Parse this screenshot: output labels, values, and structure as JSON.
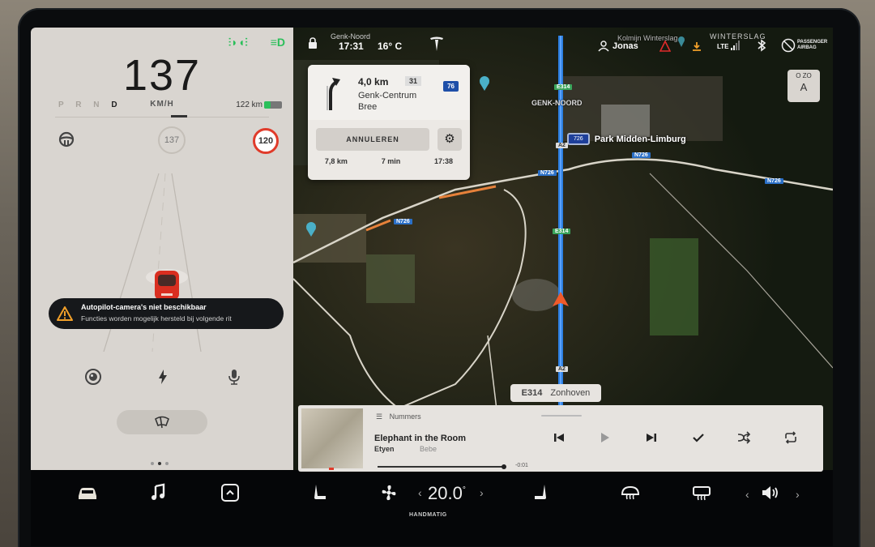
{
  "left_panel": {
    "speed": "137",
    "gears": [
      "P",
      "R",
      "N",
      "D"
    ],
    "active_gear": "D",
    "speed_unit": "KM/H",
    "range": "122 km",
    "battery_level": 0.35,
    "set_speed": "137",
    "speed_limit": "120",
    "alert": {
      "title": "Autopilot-camera's niet beschikbaar",
      "subtitle": "Functies worden mogelijk hersteld bij volgende rit"
    },
    "page_count": 3,
    "active_page": 2
  },
  "status_bar": {
    "location": "Genk-Noord",
    "time": "17:31",
    "temperature": "16° C",
    "user": "Jonas",
    "network": "LTE",
    "airbag_label": "PASSENGER AIRBAG"
  },
  "navigation": {
    "distance": "4,0 km",
    "exit_number": "31",
    "route_badge": "76",
    "destination_line1": "Genk-Centrum",
    "destination_line2": "Bree",
    "cancel_label": "ANNULEREN",
    "trip_distance": "7,8 km",
    "trip_time": "7 min",
    "arrival": "17:38"
  },
  "map": {
    "labels": [
      "Kolmijn Winterslag",
      "WINTERSLAG",
      "GENK-NOORD"
    ],
    "poi": {
      "badge": "726",
      "name": "Park Midden-Limburg"
    },
    "road_tags": [
      "E314",
      "A2",
      "N726",
      "N726",
      "N726",
      "N726",
      "E314",
      "A2"
    ],
    "street": {
      "road": "E314",
      "name": "Zonhoven"
    },
    "compass": {
      "top": "O ZO",
      "letter": "A"
    }
  },
  "media": {
    "source": "Nummers",
    "title": "Elephant in the Room",
    "artist": "Etyen",
    "album": "Bebe",
    "time_remaining": "-0:01",
    "progress": 0.98
  },
  "dock": {
    "temperature": "20.0",
    "temperature_unit": "°",
    "climate_mode": "HANDMATIG"
  }
}
